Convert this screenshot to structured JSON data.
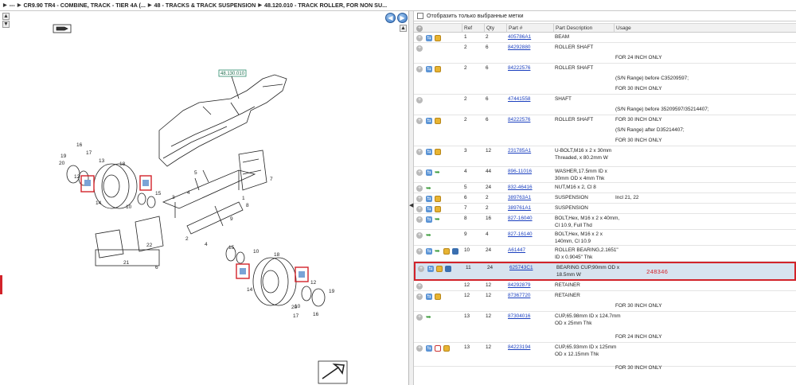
{
  "breadcrumb": {
    "items": [
      "---",
      "CR9.90 TR4 - COMBINE, TRACK - TIER 4A (...",
      "48 - TRACKS & TRACK SUSPENSION",
      "48.120.010 - TRACK ROLLER, FOR NON SU..."
    ]
  },
  "diagram": {
    "ref_label": "48.130.010",
    "callouts": [
      "16",
      "17",
      "19",
      "20",
      "12",
      "13",
      "14",
      "18",
      "11",
      "10",
      "15",
      "5",
      "4",
      "3",
      "1",
      "7",
      "8",
      "2",
      "9",
      "22",
      "21",
      "6",
      "4",
      "2",
      "15",
      "10",
      "11",
      "13",
      "14",
      "18",
      "12",
      "19",
      "20",
      "17",
      "16",
      "11"
    ]
  },
  "filter": {
    "label": "Отобразить только выбранные метки"
  },
  "columns": [
    "Ref",
    "Qty",
    "Part #",
    "Part Description",
    "Usage"
  ],
  "rows": [
    {
      "ref": "1",
      "qty": "2",
      "part": "405786A1",
      "desc": [
        "BEAM"
      ],
      "usage": [],
      "icons": [
        "swap",
        "box"
      ]
    },
    {
      "ref": "2",
      "qty": "6",
      "part": "84292880",
      "desc": [
        "ROLLER SHAFT"
      ],
      "usage": [
        "",
        "FOR 24 INCH ONLY"
      ],
      "icons": []
    },
    {
      "ref": "2",
      "qty": "6",
      "part": "84222576",
      "desc": [
        "ROLLER SHAFT"
      ],
      "usage": [
        "",
        "(S/N Range) before C35209597;",
        "FOR 30 INCH ONLY"
      ],
      "icons": [
        "swap",
        "box"
      ]
    },
    {
      "ref": "2",
      "qty": "6",
      "part": "47441558",
      "desc": [
        "SHAFT"
      ],
      "usage": [
        "",
        "(S/N Range) before 35209597/35214407;",
        "FOR 30 INCH ONLY"
      ],
      "icons": []
    },
    {
      "ref": "2",
      "qty": "6",
      "part": "84222576",
      "desc": [
        "ROLLER SHAFT"
      ],
      "usage": [
        "",
        "(S/N Range) after D35214407;",
        "FOR 30 INCH ONLY"
      ],
      "icons": [
        "swap",
        "box"
      ]
    },
    {
      "ref": "3",
      "qty": "12",
      "part": "231785A1",
      "desc": [
        "U-BOLT,M16 x 2 x 30mm",
        "Threaded, x 80.2mm W"
      ],
      "usage": [],
      "icons": [
        "swap",
        "box"
      ]
    },
    {
      "ref": "4",
      "qty": "44",
      "part": "896-11016",
      "desc": [
        "WASHER,17.5mm ID x",
        "30mm OD x 4mm Thk"
      ],
      "usage": [],
      "icons": [
        "swap",
        "green"
      ]
    },
    {
      "ref": "5",
      "qty": "24",
      "part": "832-46416",
      "desc": [
        "NUT,M16 x 2, Cl 8"
      ],
      "usage": [],
      "icons": [
        "green"
      ]
    },
    {
      "ref": "6",
      "qty": "2",
      "part": "389763A1",
      "desc": [
        "SUSPENSION"
      ],
      "usage": [
        "Incl 21, 22"
      ],
      "icons": [
        "swap",
        "box"
      ]
    },
    {
      "ref": "7",
      "qty": "2",
      "part": "389761A1",
      "desc": [
        "SUSPENSION"
      ],
      "usage": [],
      "icons": [
        "swap",
        "box"
      ]
    },
    {
      "ref": "8",
      "qty": "16",
      "part": "827-16040",
      "desc": [
        "BOLT,Hex, M16 x 2 x 40mm,",
        "Cl 10.9, Full Thd"
      ],
      "usage": [],
      "icons": [
        "swap",
        "green"
      ]
    },
    {
      "ref": "9",
      "qty": "4",
      "part": "827-16140",
      "desc": [
        "BOLT,Hex, M16 x 2 x",
        "140mm, Cl 10.9"
      ],
      "usage": [],
      "icons": [
        "green"
      ]
    },
    {
      "ref": "10",
      "qty": "24",
      "part": "A61447",
      "desc": [
        "ROLLER BEARING,2.1651\"",
        "ID x 0.9045\" Thk"
      ],
      "usage": [],
      "icons": [
        "swap",
        "green",
        "box",
        "globe"
      ]
    },
    {
      "ref": "11",
      "qty": "24",
      "part": "625743C1",
      "desc": [
        "BEARING CUP,90mm OD x",
        "18.5mm W"
      ],
      "usage": [],
      "icons": [
        "swap",
        "box",
        "globe"
      ],
      "selected": true,
      "note": "248346"
    },
    {
      "ref": "12",
      "qty": "12",
      "part": "84292879",
      "desc": [
        "RETAINER"
      ],
      "usage": [],
      "icons": []
    },
    {
      "ref": "12",
      "qty": "12",
      "part": "87367720",
      "desc": [
        "RETAINER"
      ],
      "usage": [
        "",
        "FOR 30 INCH ONLY"
      ],
      "icons": [
        "swap",
        "box"
      ]
    },
    {
      "ref": "13",
      "qty": "12",
      "part": "87304016",
      "desc": [
        "CUP,65.98mm ID x 124.7mm",
        "OD x 25mm Thk"
      ],
      "usage": [
        "",
        "",
        "FOR 24 INCH ONLY"
      ],
      "icons": [
        "green"
      ]
    },
    {
      "ref": "13",
      "qty": "12",
      "part": "84223194",
      "desc": [
        "CUP,65.93mm ID x 125mm",
        "OD x 12.15mm Thk"
      ],
      "usage": [
        "",
        "",
        "FOR 30 INCH ONLY"
      ],
      "icons": [
        "swap",
        "list",
        "box"
      ]
    }
  ],
  "colors": {
    "accent": "#1a3fbf",
    "selection": "#d7e3ef",
    "highlight": "#d2232a"
  }
}
